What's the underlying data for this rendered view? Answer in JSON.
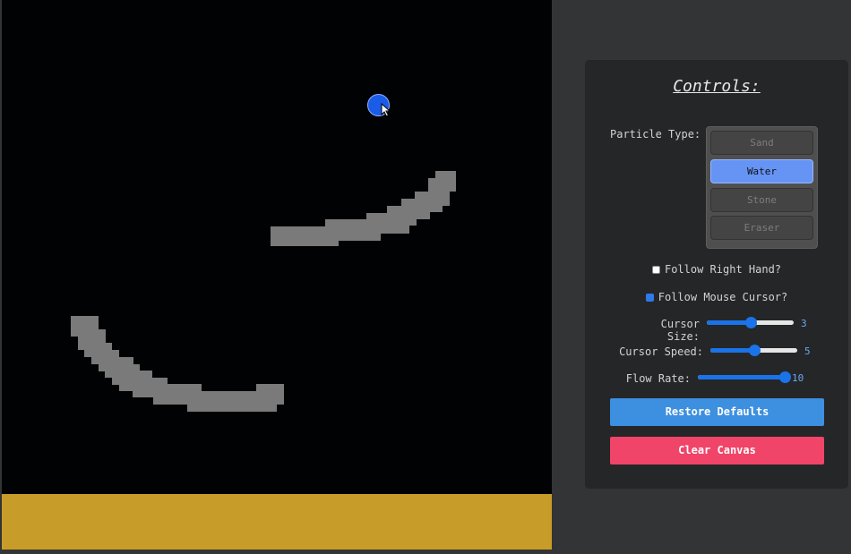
{
  "controls": {
    "title": "Controls:",
    "particle_type_label": "Particle Type:",
    "particle_types": [
      "Sand",
      "Water",
      "Stone",
      "Eraser"
    ],
    "selected_particle_type": "Water",
    "follow_right_hand": {
      "label": "Follow Right Hand?",
      "checked": false
    },
    "follow_mouse_cursor": {
      "label": "Follow Mouse Cursor?",
      "checked": true
    },
    "sliders": {
      "cursor_size": {
        "label": "Cursor Size:",
        "value": "3",
        "fraction": 0.5
      },
      "cursor_speed": {
        "label": "Cursor Speed:",
        "value": "5",
        "fraction": 0.5
      },
      "flow_rate": {
        "label": "Flow Rate:",
        "value": "10",
        "fraction": 1.0
      }
    },
    "restore_defaults_label": "Restore Defaults",
    "clear_canvas_label": "Clear Canvas"
  },
  "colors": {
    "background": "#333435",
    "canvas": "#010203",
    "sand": "#c89c28",
    "stone": "#7a7a7a",
    "water_cursor": "#1a5ce8",
    "selected_option": "#6694f5",
    "restore_button": "#3d8fe0",
    "clear_button": "#f04468",
    "slider_accent": "#1a73e8"
  }
}
